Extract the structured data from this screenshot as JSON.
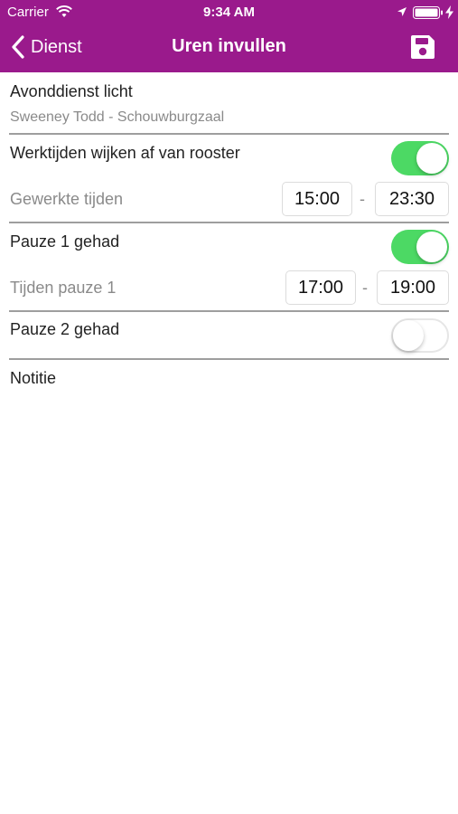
{
  "status_bar": {
    "carrier": "Carrier",
    "time": "9:34 AM"
  },
  "nav": {
    "back_label": "Dienst",
    "title": "Uren invullen",
    "save_icon": "save-icon"
  },
  "shift": {
    "title": "Avonddienst licht",
    "subtitle": "Sweeney Todd - Schouwburgzaal"
  },
  "work_times": {
    "toggle_label": "Werktijden wijken af van rooster",
    "toggle_on": true,
    "times_label": "Gewerkte tijden",
    "start": "15:00",
    "separator": "-",
    "end": "23:30"
  },
  "pause1": {
    "toggle_label": "Pauze 1 gehad",
    "toggle_on": true,
    "times_label": "Tijden pauze 1",
    "start": "17:00",
    "separator": "-",
    "end": "19:00"
  },
  "pause2": {
    "toggle_label": "Pauze 2 gehad",
    "toggle_on": false
  },
  "note": {
    "label": "Notitie"
  },
  "colors": {
    "header": "#9a1a8c",
    "toggle_on": "#4cd964"
  }
}
